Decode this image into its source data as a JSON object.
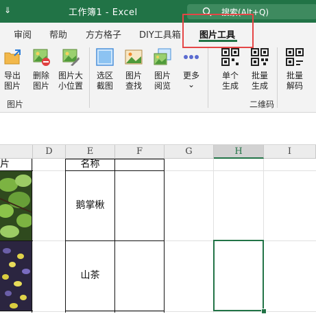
{
  "window": {
    "qat_symbol": "⇓",
    "title": "工作簿1 - Excel",
    "search_placeholder": "搜索(Alt+Q)"
  },
  "tabs": [
    {
      "label": "审阅"
    },
    {
      "label": "帮助"
    },
    {
      "label": "方方格子"
    },
    {
      "label": "DIY工具箱"
    },
    {
      "label": "图片工具",
      "active": true
    }
  ],
  "ribbon": {
    "group_picture": {
      "label": "图片",
      "buttons": [
        {
          "line1": "导出",
          "line2": "图片",
          "icon": "export-picture-icon"
        },
        {
          "line1": "删除",
          "line2": "图片",
          "icon": "delete-picture-icon"
        },
        {
          "line1": "图片大",
          "line2": "小位置",
          "icon": "picture-size-icon"
        },
        {
          "line1": "选区",
          "line2": "截图",
          "icon": "screenshot-icon"
        },
        {
          "line1": "图片",
          "line2": "查找",
          "icon": "find-picture-icon"
        },
        {
          "line1": "图片",
          "line2": "阅览",
          "icon": "view-picture-icon"
        },
        {
          "line1": "更多",
          "line2": "⌄",
          "icon": "more-icon"
        }
      ]
    },
    "group_qr": {
      "label": "二维码",
      "buttons": [
        {
          "line1": "单个",
          "line2": "生成",
          "icon": "qr-single-icon"
        },
        {
          "line1": "批量",
          "line2": "生成",
          "icon": "qr-batch-icon"
        },
        {
          "line1": "批量",
          "line2": "解码",
          "icon": "qr-decode-icon"
        }
      ]
    }
  },
  "sheet": {
    "columns": [
      "D",
      "E",
      "F",
      "G",
      "H",
      "I"
    ],
    "selected_column": "H",
    "header_row": {
      "c_partial": "片",
      "e": "名称"
    },
    "rows": [
      {
        "e": "鹅掌楸"
      },
      {
        "e": "山茶"
      }
    ]
  },
  "colors": {
    "accent": "#217346",
    "highlight": "#e54545"
  }
}
